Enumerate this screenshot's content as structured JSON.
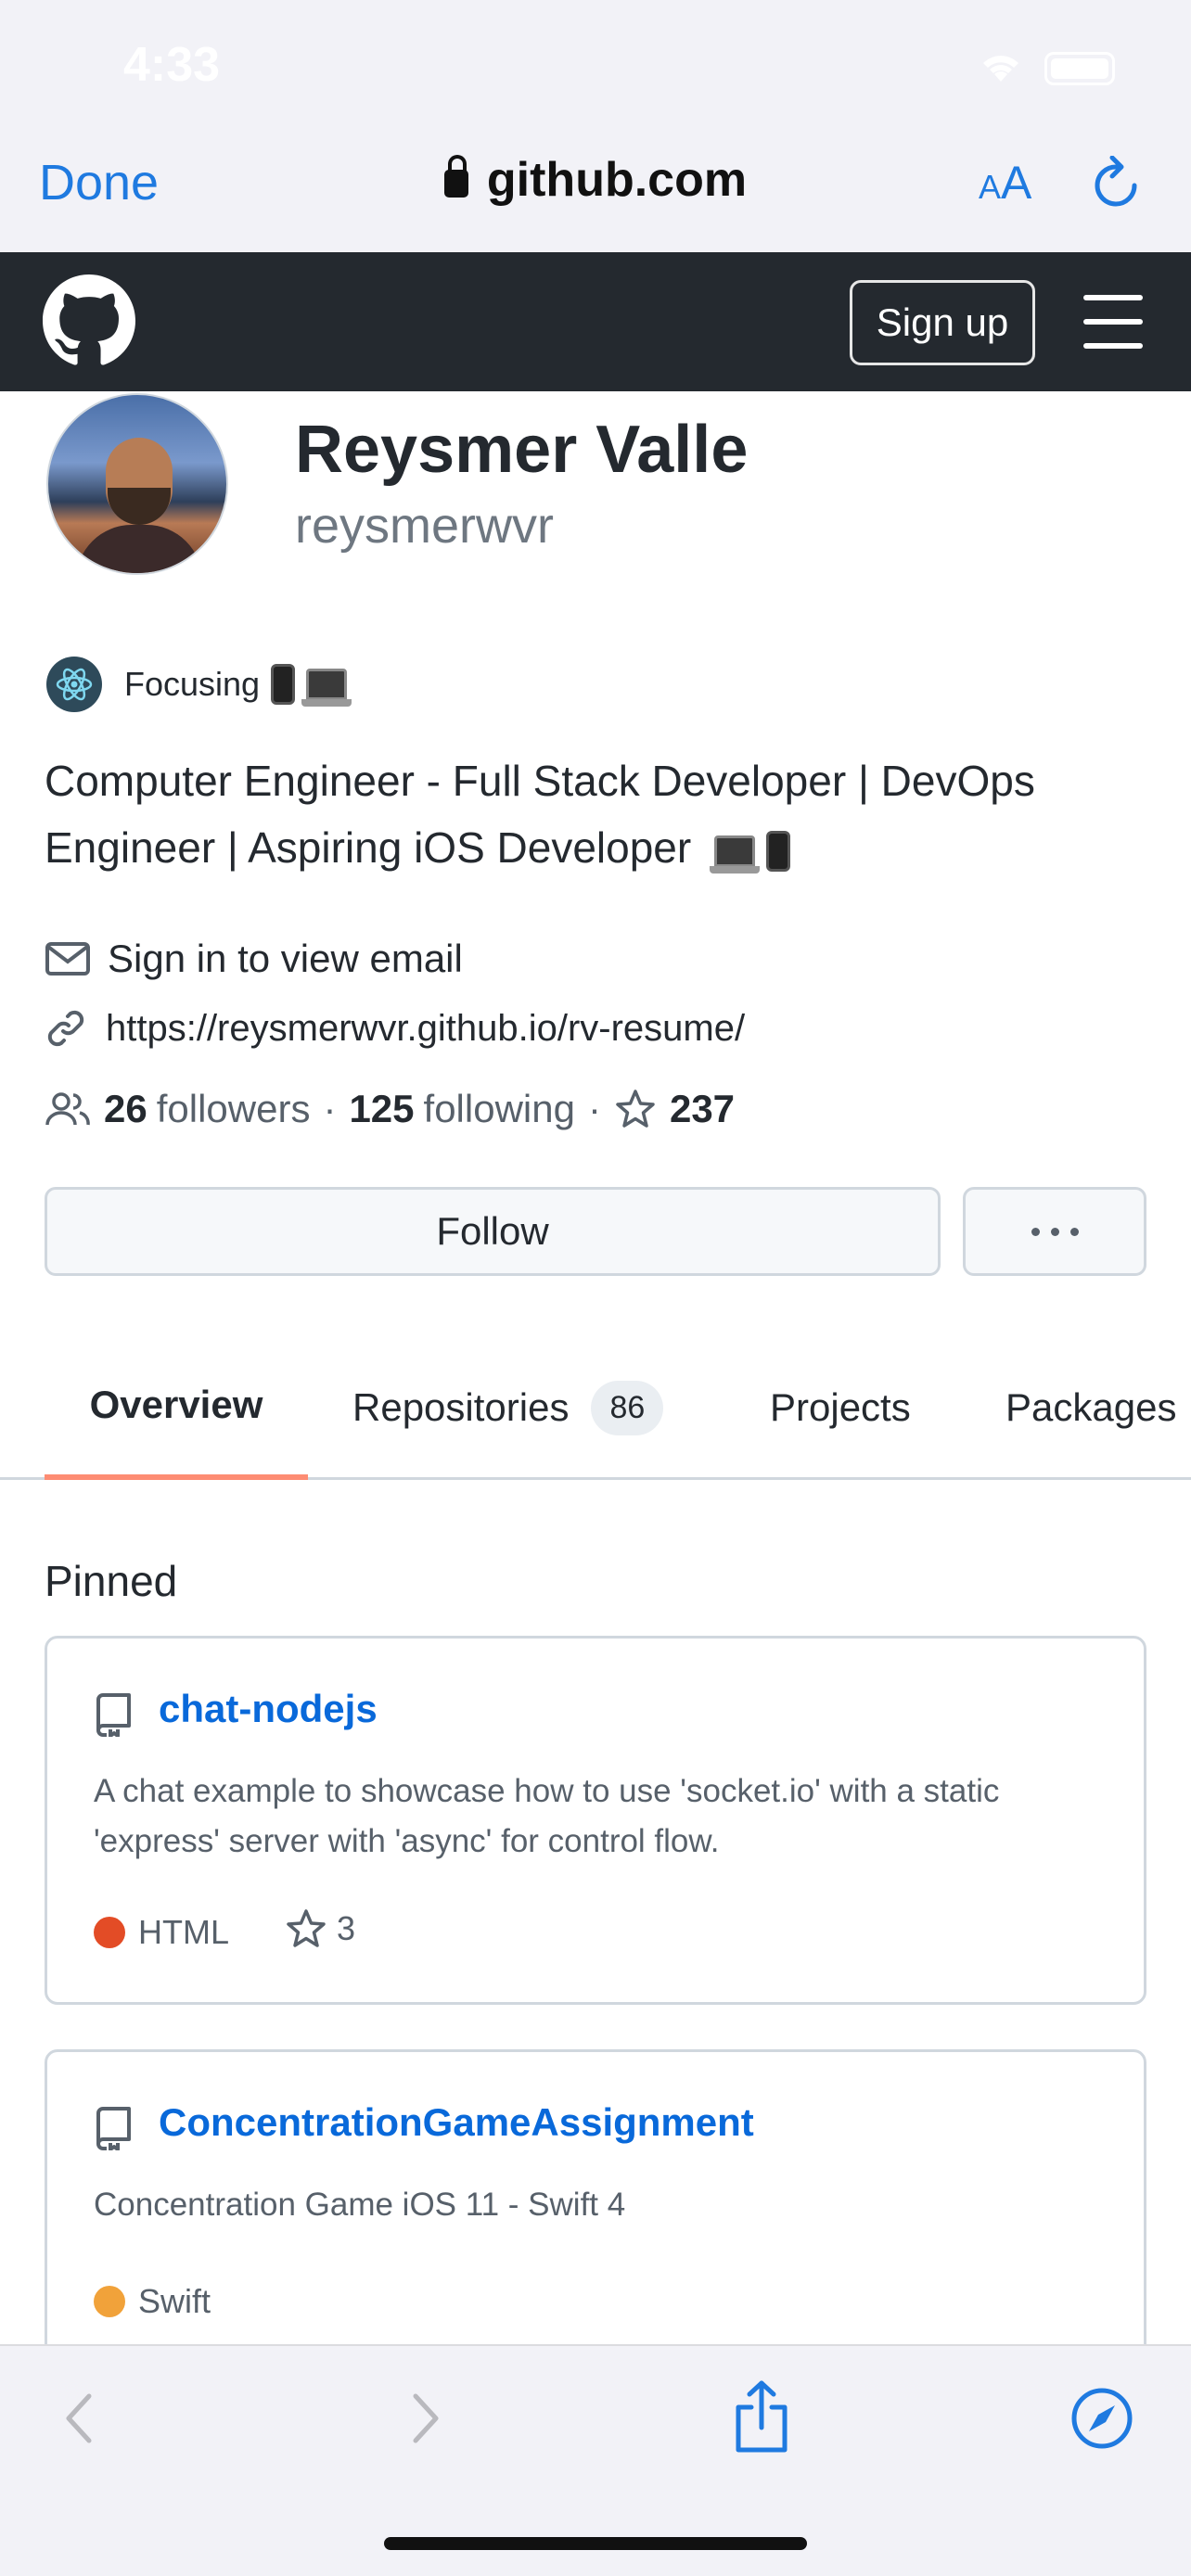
{
  "status_bar": {
    "time": "4:33"
  },
  "browser": {
    "done_label": "Done",
    "url": "github.com",
    "text_size_small": "A",
    "text_size_big": "A"
  },
  "github_header": {
    "signup_label": "Sign up"
  },
  "profile": {
    "name": "Reysmer Valle",
    "login": "reysmerwvr",
    "status_text": "Focusing",
    "bio": "Computer Engineer - Full Stack Developer | DevOps Engineer | Aspiring iOS Developer",
    "email_text": "Sign in to view email",
    "website": "https://reysmerwvr.github.io/rv-resume/",
    "followers_count": "26",
    "followers_label": "followers",
    "following_count": "125",
    "following_label": "following",
    "separator": "·",
    "stars_count": "237",
    "follow_label": "Follow"
  },
  "tabs": [
    {
      "label": "Overview"
    },
    {
      "label": "Repositories",
      "count": "86"
    },
    {
      "label": "Projects"
    },
    {
      "label": "Packages"
    }
  ],
  "pinned": {
    "heading": "Pinned",
    "repos": [
      {
        "name": "chat-nodejs",
        "description": "A chat example to showcase how to use 'socket.io' with a static 'express' server with 'async' for control flow.",
        "language": "HTML",
        "language_color": "#e34c26",
        "stars": "3"
      },
      {
        "name": "ConcentrationGameAssignment",
        "description": "Concentration Game iOS 11 - Swift 4",
        "language": "Swift",
        "language_color": "#f1a23a"
      }
    ]
  },
  "colors": {
    "link": "#0969da",
    "ios_accent": "#1f7ae0",
    "header_bg": "#24292f",
    "tab_underline": "#fd8c73"
  }
}
